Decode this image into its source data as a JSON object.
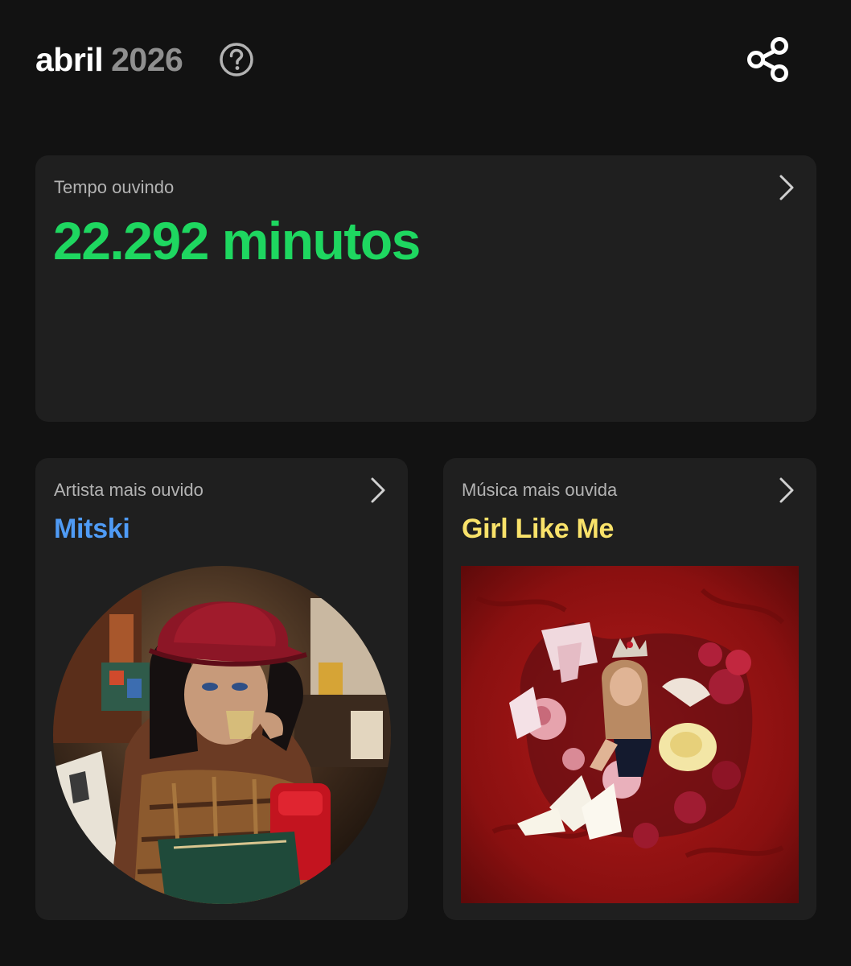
{
  "header": {
    "month": "abril",
    "year": "2026",
    "help_icon": "question-circle-icon",
    "share_icon": "share-icon"
  },
  "listening_time": {
    "label": "Tempo ouvindo",
    "value": "22.292 minutos",
    "accent_color": "#1ed760"
  },
  "top_artist": {
    "label": "Artista mais ouvido",
    "name": "Mitski",
    "accent_color": "#4f9bf5"
  },
  "top_track": {
    "label": "Música mais ouvida",
    "title": "Girl Like Me",
    "accent_color": "#f9e26a"
  },
  "icons": {
    "chevron": "chevron-right-icon"
  }
}
